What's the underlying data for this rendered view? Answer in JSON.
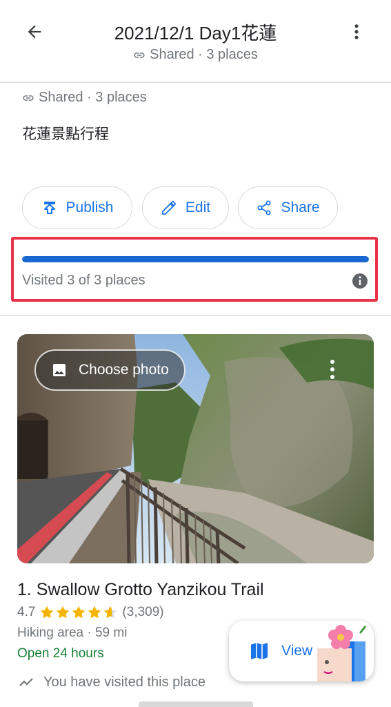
{
  "header": {
    "title": "2021/12/1 Day1花蓮",
    "subtitle": "Shared · 3 places"
  },
  "list_meta": {
    "shared_text": "Shared · 3 places",
    "description": "花蓮景點行程"
  },
  "actions": {
    "publish_label": "Publish",
    "edit_label": "Edit",
    "share_label": "Share"
  },
  "progress": {
    "visited": 3,
    "total": 3,
    "fraction": 1.0,
    "label": "Visited 3 of 3 places"
  },
  "place": {
    "choose_photo_label": "Choose photo",
    "title": "1. Swallow Grotto Yanzikou Trail",
    "rating": "4.7",
    "rating_value": 4.7,
    "review_count": "(3,309)",
    "category_distance": "Hiking area · 59 mi",
    "hours": "Open 24 hours",
    "visited_note": "You have visited this place"
  },
  "view_button": {
    "label": "View"
  },
  "icons": {
    "back": "arrow-back-icon",
    "more": "more-vert-icon",
    "link": "link-icon",
    "publish": "publish-icon",
    "edit": "pencil-icon",
    "share": "share-icon",
    "info": "info-icon",
    "photo": "image-icon",
    "trend": "trending-icon",
    "map": "map-icon"
  },
  "colors": {
    "accent": "#1a73e8",
    "progress": "#1a66d2",
    "highlight_border": "#e8334a",
    "open_green": "#188038",
    "star": "#f4b400"
  }
}
